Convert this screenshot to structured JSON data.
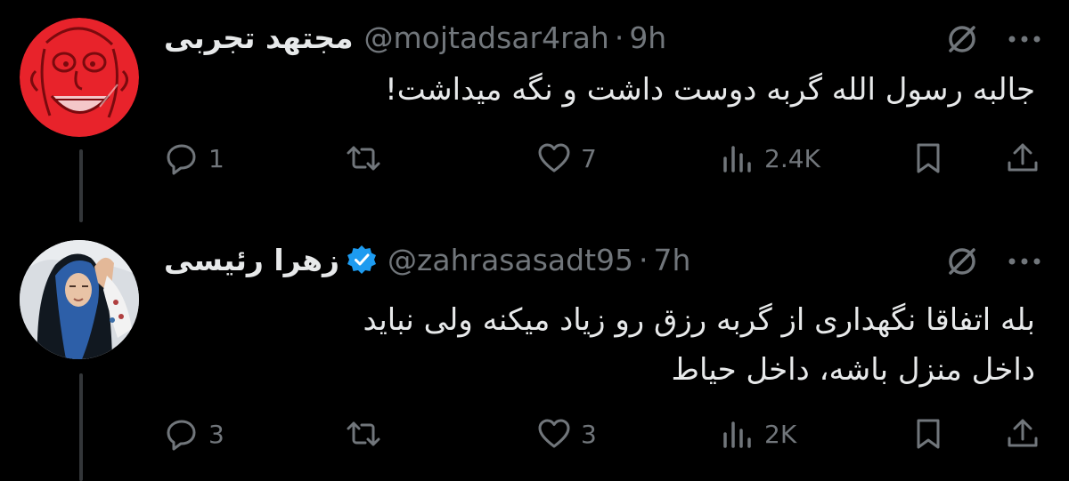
{
  "tweets": [
    {
      "display_name": "مجتهد تجربی",
      "handle": "@mojtadsar4rah",
      "separator": "·",
      "time": "9h",
      "verified": false,
      "text_lines": [
        "جالبه رسول الله گربه دوست داشت و نگه میداشت!"
      ],
      "actions": {
        "replies": "1",
        "reposts": "",
        "likes": "7",
        "views": "2.4K"
      },
      "avatar": "red-cartoon-face"
    },
    {
      "display_name": "زهرا رئیسی",
      "handle": "@zahrasasadt95",
      "separator": "·",
      "time": "7h",
      "verified": true,
      "text_lines": [
        "بله اتفاقا نگهداری از گربه رزق رو زیاد میکنه ولی نباید",
        "داخل منزل باشه، داخل حیاط"
      ],
      "actions": {
        "replies": "3",
        "reposts": "",
        "likes": "3",
        "views": "2K"
      },
      "avatar": "woman-in-chador"
    }
  ],
  "colors": {
    "background": "#000000",
    "text": "#e7e9ea",
    "secondary": "#71767b",
    "verified": "#1d9bf0",
    "thread_line": "#333639"
  },
  "icons": [
    "grok-icon",
    "more-icon",
    "reply-icon",
    "repost-icon",
    "like-icon",
    "views-icon",
    "bookmark-icon",
    "share-icon",
    "verified-badge-icon"
  ]
}
